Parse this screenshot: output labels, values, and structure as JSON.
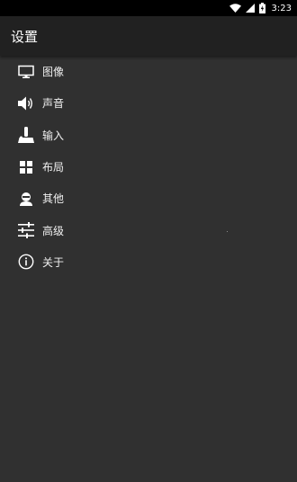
{
  "statusbar": {
    "time": "3:23",
    "icons": [
      "wifi-icon",
      "cellular-icon",
      "battery-charging-icon"
    ]
  },
  "appbar": {
    "title": "设置"
  },
  "menu": {
    "items": [
      {
        "label": "图像",
        "icon": "monitor-icon"
      },
      {
        "label": "声音",
        "icon": "speaker-icon"
      },
      {
        "label": "输入",
        "icon": "joystick-icon"
      },
      {
        "label": "布局",
        "icon": "grid-icon"
      },
      {
        "label": "其他",
        "icon": "person-icon"
      },
      {
        "label": "高级",
        "icon": "sliders-icon"
      },
      {
        "label": "关于",
        "icon": "info-icon"
      }
    ]
  },
  "colors": {
    "background": "#303030",
    "appbar": "#212121",
    "statusbar": "#000000",
    "text": "#ffffff"
  }
}
